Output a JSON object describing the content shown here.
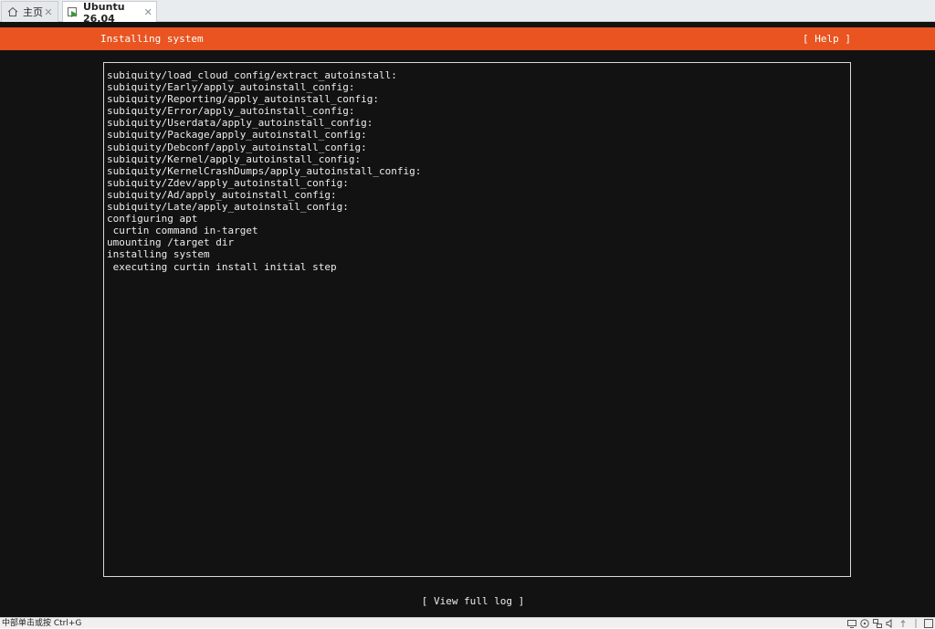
{
  "tabs": [
    {
      "label": "主页",
      "icon": "home-icon",
      "active": false
    },
    {
      "label": "Ubuntu 26.04",
      "icon": "vm-console-icon",
      "active": true
    }
  ],
  "console": {
    "header": {
      "title": "Installing system",
      "help_label": "[ Help ]"
    },
    "log_lines": [
      "subiquity/load_cloud_config/extract_autoinstall:",
      "subiquity/Early/apply_autoinstall_config:",
      "subiquity/Reporting/apply_autoinstall_config:",
      "subiquity/Error/apply_autoinstall_config:",
      "subiquity/Userdata/apply_autoinstall_config:",
      "subiquity/Package/apply_autoinstall_config:",
      "subiquity/Debconf/apply_autoinstall_config:",
      "subiquity/Kernel/apply_autoinstall_config:",
      "subiquity/KernelCrashDumps/apply_autoinstall_config:",
      "subiquity/Zdev/apply_autoinstall_config:",
      "subiquity/Ad/apply_autoinstall_config:",
      "subiquity/Late/apply_autoinstall_config:",
      "configuring apt",
      " curtin command in-target",
      "umounting /target dir",
      "installing system",
      " executing curtin install initial step"
    ],
    "view_log_label": "[ View full log ]"
  },
  "statusbar": {
    "hint": "中部单击或按 Ctrl+G"
  },
  "colors": {
    "accent": "#e95420",
    "console_bg": "#121212",
    "console_text": "#ececec"
  }
}
